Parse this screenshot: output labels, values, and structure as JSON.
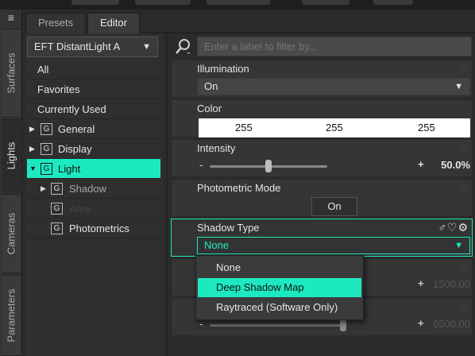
{
  "side_tabs": {
    "menu_glyph": "≡",
    "surfaces": "Surfaces",
    "lights": "Lights",
    "cameras": "Cameras",
    "parameters": "Parameters"
  },
  "top_tabs": {
    "presets": "Presets",
    "editor": "Editor"
  },
  "node_selector": {
    "value": "EFT DistantLight A",
    "arrow": "▼"
  },
  "left_list": {
    "all": "All",
    "favorites": "Favorites",
    "currently_used": "Currently Used",
    "groups": [
      {
        "label": "General",
        "expander": "▶",
        "icon": "G"
      },
      {
        "label": "Display",
        "expander": "▶",
        "icon": "G"
      },
      {
        "label": "Light",
        "expander": "▼",
        "icon": "G"
      },
      {
        "label": "Shadow",
        "expander": "▶",
        "icon": "G"
      },
      {
        "label": "Area",
        "expander": "",
        "icon": "G"
      },
      {
        "label": "Photometrics",
        "expander": "",
        "icon": "G"
      }
    ]
  },
  "filter": {
    "placeholder": "Enter a label to filter by..."
  },
  "properties": {
    "illumination": {
      "title": "Illumination",
      "value": "On",
      "arrow": "▼"
    },
    "color": {
      "title": "Color",
      "r": "255",
      "g": "255",
      "b": "255"
    },
    "intensity": {
      "title": "Intensity",
      "minus": "-",
      "plus": "+",
      "value": "50.0%",
      "level": 0.5
    },
    "photometric_mode": {
      "title": "Photometric Mode",
      "button": "On"
    },
    "shadow_type": {
      "title": "Shadow Type",
      "value": "None",
      "arrow": "▼",
      "icons": "♂♡⚙"
    },
    "hidden_slider_1": {
      "plus": "+",
      "value": "1500.00"
    },
    "hidden_slider_2": {
      "minus": "-",
      "plus": "+",
      "value": "6500.00"
    }
  },
  "shadow_dropdown": {
    "options": [
      "None",
      "Deep Shadow Map",
      "Raytraced (Software Only)"
    ],
    "highlighted": "Deep Shadow Map"
  },
  "colors": {
    "accent": "#1de9c0",
    "panel_bg": "#2b2b2b",
    "row_bg": "#353535"
  },
  "icons": {
    "filter": "search-icon",
    "gear": "gear-icon"
  }
}
